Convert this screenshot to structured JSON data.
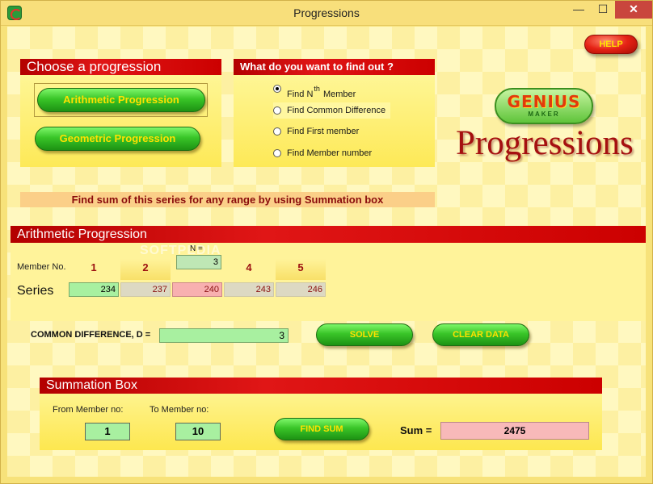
{
  "window": {
    "title": "Progressions",
    "min_glyph": "—",
    "max_glyph": "☐",
    "close_glyph": "✕"
  },
  "choose": {
    "header": "Choose a progression",
    "arithmetic": "Arithmetic Progression",
    "geometric": "Geometric Progression"
  },
  "find": {
    "header": "What do you want to find out ?",
    "options": {
      "nth_pre": "Find N",
      "nth_sup": "th",
      "nth_post": "Member",
      "common": "Find Common Difference",
      "first": "Find First member",
      "number": "Find Member number"
    },
    "selected": "nth"
  },
  "help": {
    "label": "HELP"
  },
  "logo": {
    "genius": "GENIUS",
    "maker": "MAKER",
    "app_title": "Progressions"
  },
  "banner": {
    "text": "Find sum of this series for any range by using Summation box"
  },
  "ap": {
    "header": "Arithmetic Progression",
    "member_label": "Member No.",
    "members": [
      "1",
      "2",
      "3",
      "4",
      "5"
    ],
    "n_label": "N =",
    "n_value": "3",
    "series_label": "Series",
    "series": [
      "234",
      "237",
      "240",
      "243",
      "246"
    ],
    "watermark": "SOFTPEDIA"
  },
  "cd": {
    "label": "COMMON DIFFERENCE, D =",
    "value": "3",
    "solve": "SOLVE",
    "clear": "CLEAR DATA"
  },
  "sum": {
    "header": "Summation Box",
    "from_label": "From Member no:",
    "to_label": "To Member no:",
    "from": "1",
    "to": "10",
    "find_button": "FIND SUM",
    "sum_label": "Sum =",
    "result": "2475"
  },
  "colors": {
    "header_red": "#cc0000",
    "panel_yellow": "#fde957",
    "pill_green": "#39c528",
    "pill_text": "#ffe100",
    "title_red": "#a51010"
  }
}
